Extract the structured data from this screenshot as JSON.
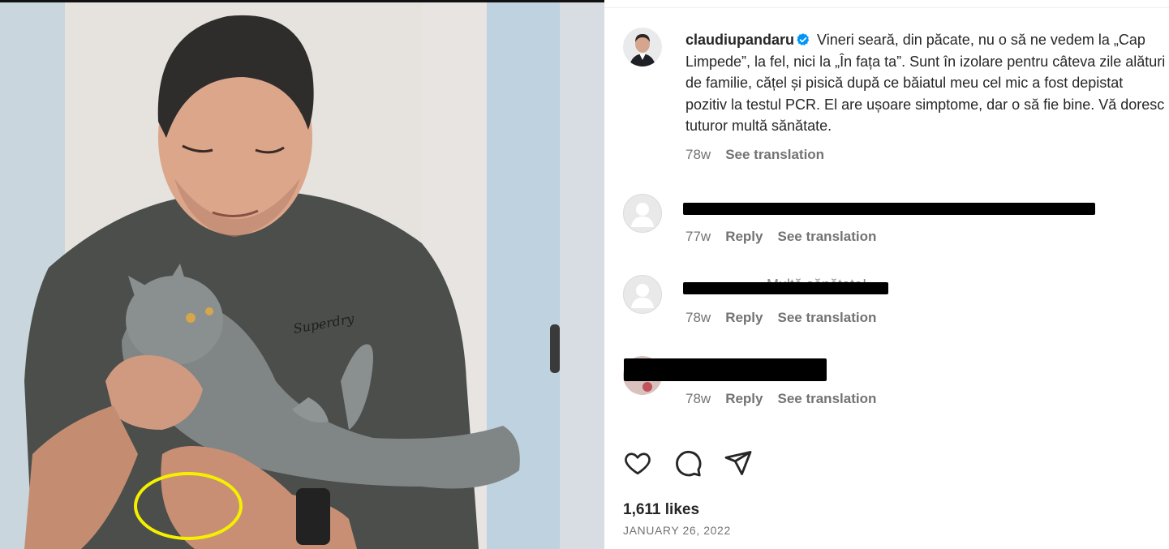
{
  "post": {
    "username": "claudiupandaru",
    "caption": "Vineri seară, din păcate, nu o să ne vedem la „Cap Limpede”, la fel, nici la „În fața ta”. Sunt în izolare pentru câteva zile alături de familie, cățel și pisică după ce băiatul meu cel mic a fost depistat pozitiv la testul PCR. El are ușoare simptome, dar o să fie bine. Vă doresc tuturor multă sănătate.",
    "age": "78w",
    "see_translation": "See translation"
  },
  "comments": [
    {
      "age": "77w",
      "reply": "Reply",
      "see_translation": "See translation"
    },
    {
      "age": "78w",
      "reply": "Reply",
      "see_translation": "See translation",
      "visible_fragment": "Multă sănătate!"
    },
    {
      "age": "78w",
      "reply": "Reply",
      "see_translation": "See translation"
    }
  ],
  "likes": "1,611 likes",
  "date": "JANUARY 26, 2022",
  "icons": {
    "verified": "verified-badge-icon",
    "like": "heart-icon",
    "comment": "comment-icon",
    "share": "share-icon",
    "avatar_placeholder": "user-avatar-icon"
  },
  "colors": {
    "verified_blue": "#0095f6",
    "annotation_circle": "#f4f000",
    "redaction": "#000000"
  }
}
